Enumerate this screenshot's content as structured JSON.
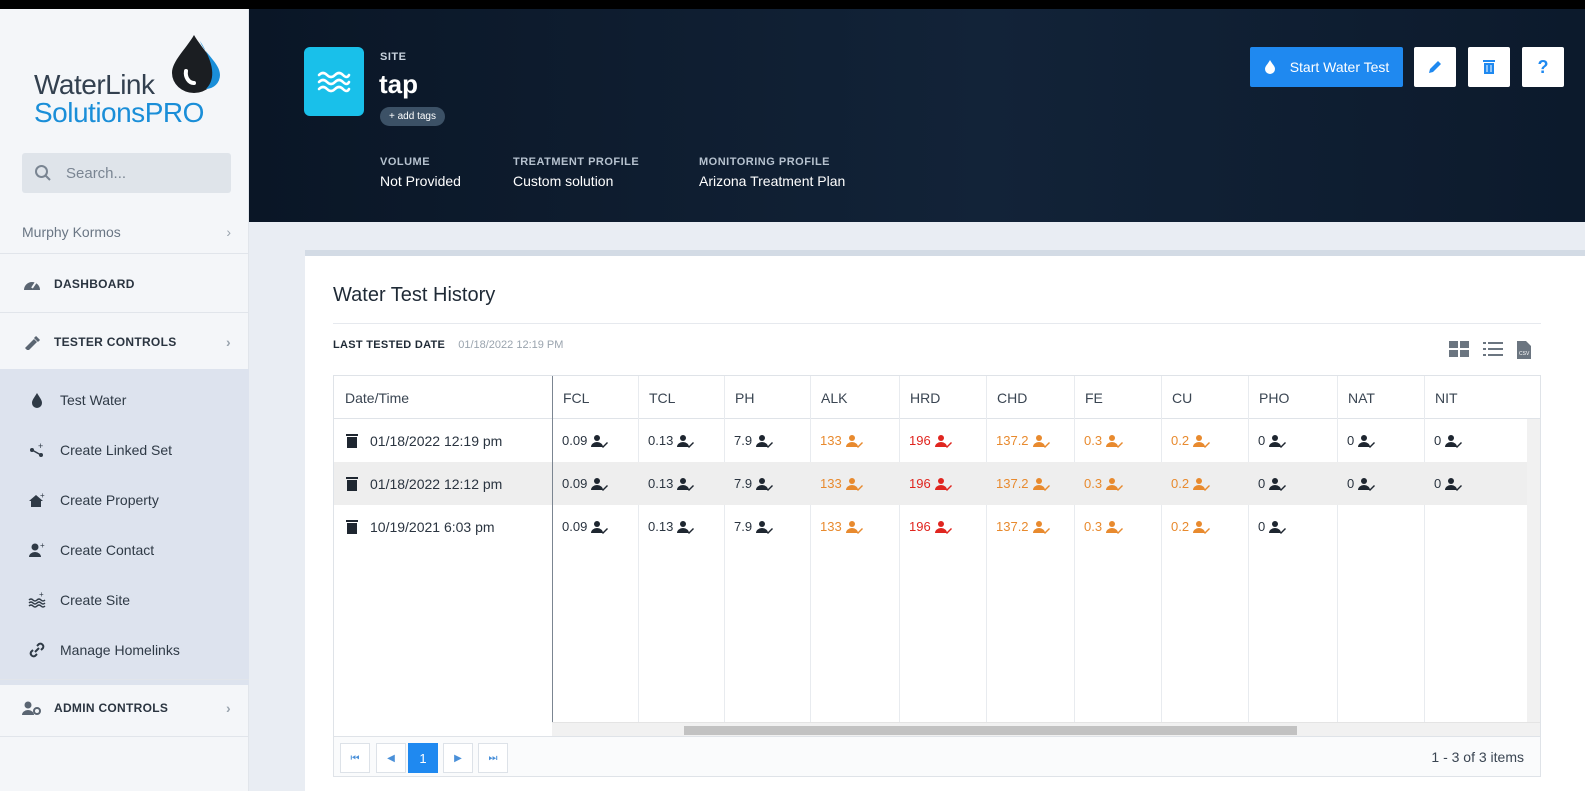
{
  "brand": {
    "line1": "WaterLink",
    "line2a": "Solutions",
    "line2b": "PRO"
  },
  "search": {
    "placeholder": "Search..."
  },
  "user": {
    "name": "Murphy Kormos"
  },
  "nav": {
    "dashboard": "DASHBOARD",
    "tester_controls": "TESTER CONTROLS",
    "admin_controls": "ADMIN CONTROLS",
    "sub_items": [
      "Test Water",
      "Create Linked Set",
      "Create Property",
      "Create Contact",
      "Create Site",
      "Manage Homelinks"
    ]
  },
  "header": {
    "site_label": "SITE",
    "site_name": "tap",
    "add_tags": "+ add tags",
    "volume_label": "VOLUME",
    "volume_value": "Not Provided",
    "treatment_label": "TREATMENT PROFILE",
    "treatment_value": "Custom solution",
    "monitoring_label": "MONITORING PROFILE",
    "monitoring_value": "Arizona Treatment Plan",
    "start_test": "Start Water Test",
    "help": "?"
  },
  "history": {
    "title": "Water Test History",
    "last_tested_label": "LAST TESTED DATE",
    "last_tested_value": "01/18/2022 12:19 PM",
    "columns": [
      "Date/Time",
      "FCL",
      "TCL",
      "PH",
      "ALK",
      "HRD",
      "CHD",
      "FE",
      "CU",
      "PHO",
      "NAT",
      "NIT"
    ],
    "rows": [
      {
        "date": "01/18/2022 12:19 pm",
        "values": [
          "0.09",
          "0.13",
          "7.9",
          "133",
          "196",
          "137.2",
          "0.3",
          "0.2",
          "0",
          "0",
          "0"
        ]
      },
      {
        "date": "01/18/2022 12:12 pm",
        "values": [
          "0.09",
          "0.13",
          "7.9",
          "133",
          "196",
          "137.2",
          "0.3",
          "0.2",
          "0",
          "0",
          "0"
        ]
      },
      {
        "date": "10/19/2021 6:03 pm",
        "values": [
          "0.09",
          "0.13",
          "7.9",
          "133",
          "196",
          "137.2",
          "0.3",
          "0.2",
          "0",
          "",
          ""
        ]
      }
    ],
    "value_status": [
      "normal",
      "normal",
      "normal",
      "orange",
      "red",
      "orange",
      "orange",
      "orange",
      "normal",
      "normal",
      "normal"
    ],
    "pager": {
      "current": "1",
      "info": "1 - 3 of 3 items"
    }
  },
  "colors": {
    "accent": "#1f89f0",
    "cyan": "#19c0ea",
    "orange": "#e88a2e",
    "red": "#e0251f"
  }
}
